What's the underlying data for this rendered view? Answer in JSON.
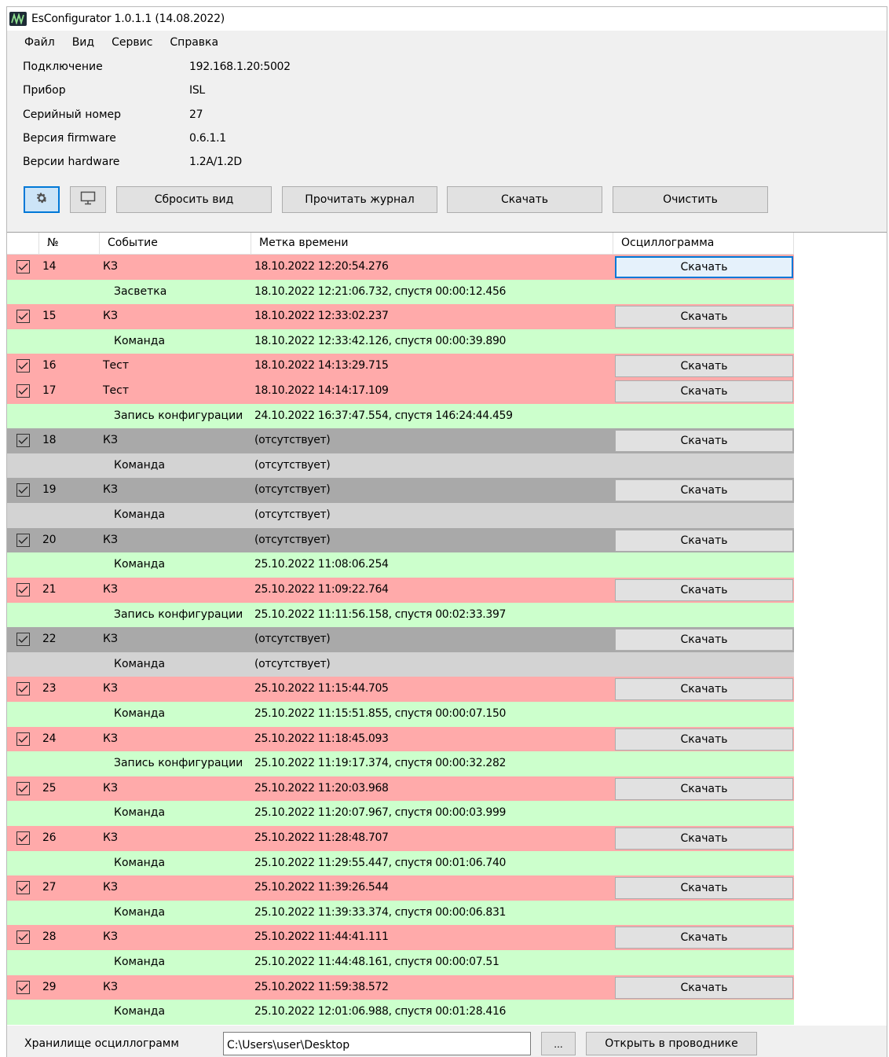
{
  "window": {
    "title": "EsConfigurator 1.0.1.1 (14.08.2022)"
  },
  "menu": [
    "Файл",
    "Вид",
    "Сервис",
    "Справка"
  ],
  "info": [
    {
      "label": "Подключение",
      "value": "192.168.1.20:5002"
    },
    {
      "label": "Прибор",
      "value": "ISL"
    },
    {
      "label": "Серийный номер",
      "value": "27"
    },
    {
      "label": "Версия firmware",
      "value": "0.6.1.1"
    },
    {
      "label": "Версии hardware",
      "value": "1.2A/1.2D"
    }
  ],
  "toolbar": {
    "settings_icon": "gear-icon",
    "monitor_icon": "monitor-icon",
    "reset_view": "Сбросить вид",
    "read_log": "Прочитать журнал",
    "download": "Скачать",
    "clear": "Очистить"
  },
  "grid": {
    "columns": {
      "num": "№",
      "event": "Событие",
      "timestamp": "Метка времени",
      "oscillogram": "Осциллограмма"
    },
    "rows": [
      {
        "kind": "main",
        "color": "red",
        "checked": true,
        "num": "14",
        "event": "КЗ",
        "time": "18.10.2022 12:20:54.276",
        "download": "Скачать",
        "focused": true
      },
      {
        "kind": "sub",
        "color": "green",
        "event": "Засветка",
        "time": "18.10.2022 12:21:06.732, спустя 00:00:12.456"
      },
      {
        "kind": "main",
        "color": "red",
        "checked": true,
        "num": "15",
        "event": "КЗ",
        "time": "18.10.2022 12:33:02.237",
        "download": "Скачать"
      },
      {
        "kind": "sub",
        "color": "green",
        "event": "Команда",
        "time": "18.10.2022 12:33:42.126, спустя 00:00:39.890"
      },
      {
        "kind": "main",
        "color": "red",
        "checked": true,
        "num": "16",
        "event": "Тест",
        "time": "18.10.2022 14:13:29.715",
        "download": "Скачать"
      },
      {
        "kind": "main",
        "color": "red",
        "checked": true,
        "num": "17",
        "event": "Тест",
        "time": "18.10.2022 14:14:17.109",
        "download": "Скачать"
      },
      {
        "kind": "sub",
        "color": "green",
        "event": "Запись конфигурации",
        "time": "24.10.2022 16:37:47.554, спустя 146:24:44.459"
      },
      {
        "kind": "main",
        "color": "grey",
        "checked": true,
        "num": "18",
        "event": "КЗ",
        "time": "(отсутствует)",
        "download": "Скачать"
      },
      {
        "kind": "sub",
        "color": "lightgrey",
        "event": "Команда",
        "time": "(отсутствует)"
      },
      {
        "kind": "main",
        "color": "grey",
        "checked": true,
        "num": "19",
        "event": "КЗ",
        "time": "(отсутствует)",
        "download": "Скачать"
      },
      {
        "kind": "sub",
        "color": "lightgrey",
        "event": "Команда",
        "time": "(отсутствует)"
      },
      {
        "kind": "main",
        "color": "grey",
        "checked": true,
        "num": "20",
        "event": "КЗ",
        "time": "(отсутствует)",
        "download": "Скачать"
      },
      {
        "kind": "sub",
        "color": "green",
        "event": "Команда",
        "time": "25.10.2022 11:08:06.254"
      },
      {
        "kind": "main",
        "color": "red",
        "checked": true,
        "num": "21",
        "event": "КЗ",
        "time": "25.10.2022 11:09:22.764",
        "download": "Скачать"
      },
      {
        "kind": "sub",
        "color": "green",
        "event": "Запись конфигурации",
        "time": "25.10.2022 11:11:56.158, спустя 00:02:33.397"
      },
      {
        "kind": "main",
        "color": "grey",
        "checked": true,
        "num": "22",
        "event": "КЗ",
        "time": "(отсутствует)",
        "download": "Скачать"
      },
      {
        "kind": "sub",
        "color": "lightgrey",
        "event": "Команда",
        "time": "(отсутствует)"
      },
      {
        "kind": "main",
        "color": "red",
        "checked": true,
        "num": "23",
        "event": "КЗ",
        "time": "25.10.2022 11:15:44.705",
        "download": "Скачать"
      },
      {
        "kind": "sub",
        "color": "green",
        "event": "Команда",
        "time": "25.10.2022 11:15:51.855, спустя 00:00:07.150"
      },
      {
        "kind": "main",
        "color": "red",
        "checked": true,
        "num": "24",
        "event": "КЗ",
        "time": "25.10.2022 11:18:45.093",
        "download": "Скачать"
      },
      {
        "kind": "sub",
        "color": "green",
        "event": "Запись конфигурации",
        "time": "25.10.2022 11:19:17.374, спустя 00:00:32.282"
      },
      {
        "kind": "main",
        "color": "red",
        "checked": true,
        "num": "25",
        "event": "КЗ",
        "time": "25.10.2022 11:20:03.968",
        "download": "Скачать"
      },
      {
        "kind": "sub",
        "color": "green",
        "event": "Команда",
        "time": "25.10.2022 11:20:07.967, спустя 00:00:03.999"
      },
      {
        "kind": "main",
        "color": "red",
        "checked": true,
        "num": "26",
        "event": "КЗ",
        "time": "25.10.2022 11:28:48.707",
        "download": "Скачать"
      },
      {
        "kind": "sub",
        "color": "green",
        "event": "Команда",
        "time": "25.10.2022 11:29:55.447, спустя 00:01:06.740"
      },
      {
        "kind": "main",
        "color": "red",
        "checked": true,
        "num": "27",
        "event": "КЗ",
        "time": "25.10.2022 11:39:26.544",
        "download": "Скачать"
      },
      {
        "kind": "sub",
        "color": "green",
        "event": "Команда",
        "time": "25.10.2022 11:39:33.374, спустя 00:00:06.831"
      },
      {
        "kind": "main",
        "color": "red",
        "checked": true,
        "num": "28",
        "event": "КЗ",
        "time": "25.10.2022 11:44:41.111",
        "download": "Скачать"
      },
      {
        "kind": "sub",
        "color": "green",
        "event": "Команда",
        "time": "25.10.2022 11:44:48.161, спустя 00:00:07.51"
      },
      {
        "kind": "main",
        "color": "red",
        "checked": true,
        "num": "29",
        "event": "КЗ",
        "time": "25.10.2022 11:59:38.572",
        "download": "Скачать"
      },
      {
        "kind": "sub",
        "color": "green",
        "event": "Команда",
        "time": "25.10.2022 12:01:06.988, спустя 00:01:28.416"
      }
    ]
  },
  "footer": {
    "storage_label": "Хранилище осциллограмм",
    "path_value": "C:\\Users\\user\\Desktop",
    "browse_label": "...",
    "open_label": "Открыть в проводнике"
  },
  "colors": {
    "red": "#ffaaaa",
    "green": "#ccffcc",
    "grey": "#a9a9a9",
    "lightgrey": "#d3d3d3",
    "accent": "#0078d7"
  }
}
